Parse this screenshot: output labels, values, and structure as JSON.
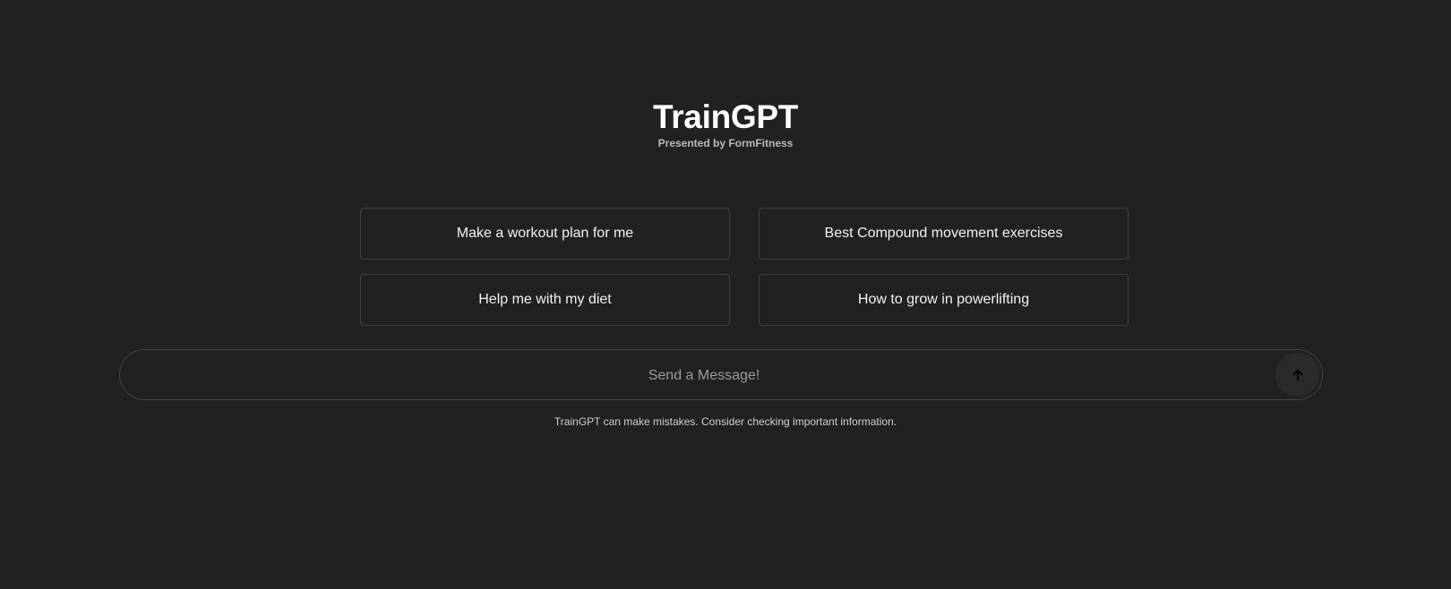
{
  "header": {
    "title": "TrainGPT",
    "subtitle": "Presented by FormFitness"
  },
  "suggestions": [
    {
      "label": "Make a workout plan for me"
    },
    {
      "label": "Best Compound movement exercises"
    },
    {
      "label": "Help me with my diet"
    },
    {
      "label": "How to grow in powerlifting"
    }
  ],
  "composer": {
    "placeholder": "Send a Message!",
    "value": "",
    "send_icon": "arrow-up-icon"
  },
  "footer": {
    "disclaimer": "TrainGPT can make mistakes. Consider checking important information."
  },
  "colors": {
    "background": "#212121",
    "border": "#3a3f52",
    "send_button": "#2a2a2a"
  }
}
